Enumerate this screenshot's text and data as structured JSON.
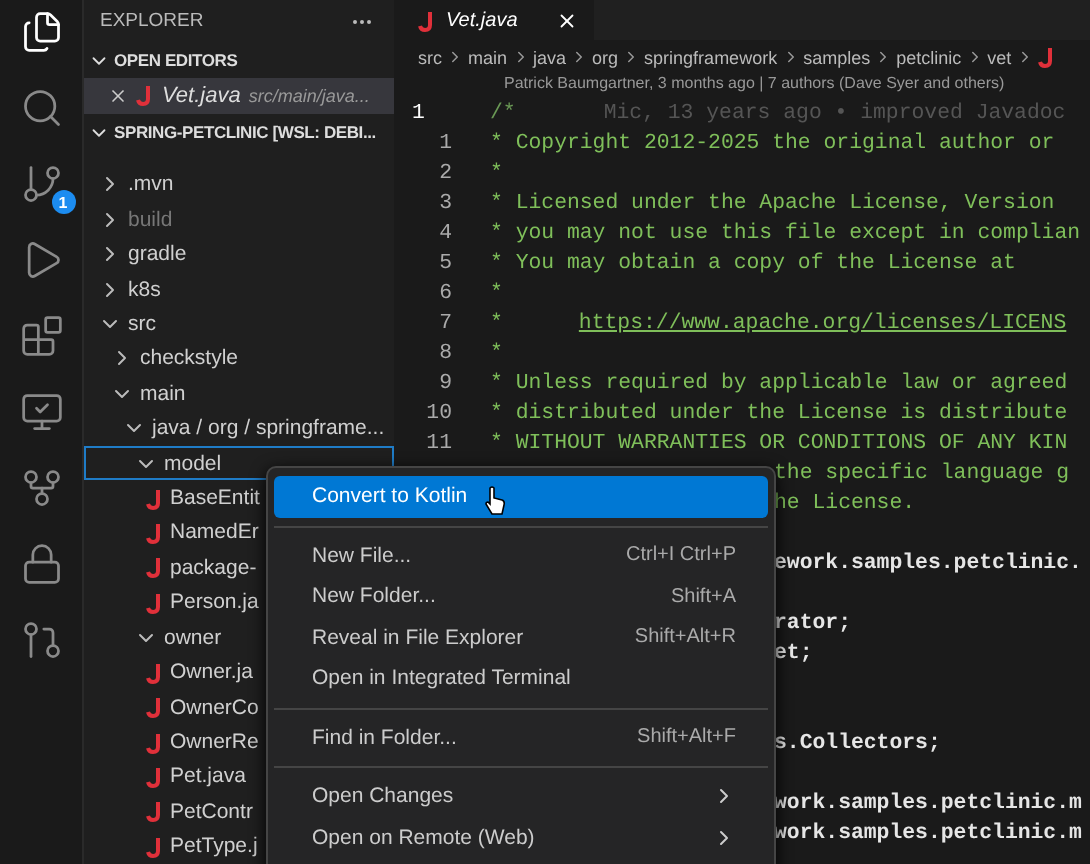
{
  "activity_bar": [
    {
      "selected": true
    },
    {
      "selected": false
    },
    {
      "selected": false,
      "badge": "1"
    },
    {
      "selected": false
    },
    {
      "selected": false
    },
    {
      "selected": false
    },
    {
      "selected": false
    },
    {
      "selected": false
    },
    {
      "selected": false
    }
  ],
  "sidebar": {
    "title": "EXPLORER",
    "open_editors": {
      "title": "OPEN EDITORS",
      "expanded": true,
      "items": [
        {
          "name": "Vet.java",
          "path": "src/main/java...",
          "selected": true
        }
      ]
    },
    "project": {
      "title": "SPRING-PETCLINIC [WSL: DEBI...",
      "expanded": true,
      "items": [
        {
          "label": ".mvn",
          "kind": "folder",
          "expanded": false,
          "dimmed": false,
          "selected": false
        },
        {
          "label": "build",
          "kind": "folder",
          "expanded": false,
          "dimmed": true,
          "selected": false
        },
        {
          "label": "gradle",
          "kind": "folder",
          "expanded": false,
          "dimmed": false,
          "selected": false
        },
        {
          "label": "k8s",
          "kind": "folder",
          "expanded": false,
          "dimmed": false,
          "selected": false
        },
        {
          "label": "src",
          "kind": "folder",
          "expanded": true,
          "dimmed": false,
          "selected": false,
          "children": [
            {
              "label": "checkstyle",
              "kind": "folder",
              "expanded": false,
              "dimmed": false,
              "selected": false
            },
            {
              "label": "main",
              "kind": "folder",
              "expanded": true,
              "dimmed": false,
              "selected": false,
              "children": [
                {
                  "label": "java / org / springframe...",
                  "kind": "folder",
                  "expanded": true,
                  "dimmed": false,
                  "selected": false,
                  "children": [
                    {
                      "label": "model",
                      "kind": "folder",
                      "expanded": true,
                      "dimmed": false,
                      "selected": true,
                      "children": [
                        {
                          "label": "BaseEntit",
                          "kind": "java",
                          "dimmed": false,
                          "selected": false
                        },
                        {
                          "label": "NamedEr",
                          "kind": "java",
                          "dimmed": false,
                          "selected": false
                        },
                        {
                          "label": "package-",
                          "kind": "java",
                          "dimmed": false,
                          "selected": false
                        },
                        {
                          "label": "Person.ja",
                          "kind": "java",
                          "dimmed": false,
                          "selected": false
                        }
                      ]
                    },
                    {
                      "label": "owner",
                      "kind": "folder",
                      "expanded": true,
                      "dimmed": false,
                      "selected": false,
                      "children": [
                        {
                          "label": "Owner.ja",
                          "kind": "java",
                          "dimmed": false,
                          "selected": false
                        },
                        {
                          "label": "OwnerCo",
                          "kind": "java",
                          "dimmed": false,
                          "selected": false
                        },
                        {
                          "label": "OwnerRe",
                          "kind": "java",
                          "dimmed": false,
                          "selected": false
                        },
                        {
                          "label": "Pet.java",
                          "kind": "java",
                          "dimmed": false,
                          "selected": false
                        },
                        {
                          "label": "PetContr",
                          "kind": "java",
                          "dimmed": false,
                          "selected": false
                        },
                        {
                          "label": "PetType.j",
                          "kind": "java",
                          "dimmed": false,
                          "selected": false
                        }
                      ]
                    }
                  ]
                }
              ]
            }
          ]
        }
      ]
    }
  },
  "editor": {
    "tabs": [
      {
        "label": "Vet.java",
        "selected": true
      }
    ],
    "breadcrumb": [
      "src",
      "main",
      "java",
      "org",
      "springframework",
      "samples",
      "petclinic",
      "vet"
    ],
    "blame": "Patrick Baumgartner, 3 months ago | 7 authors (Dave Syer and others)",
    "lines": [
      {
        "kind": "current",
        "number": "1",
        "text": "/*",
        "ghost": "Mic, 13 years ago • improved Javadoc"
      },
      {
        "kind": "comment",
        "number": "1",
        "text": "* Copyright 2012-2025 the original author or"
      },
      {
        "kind": "comment",
        "number": "2",
        "text": "*"
      },
      {
        "kind": "comment",
        "number": "3",
        "text": "* Licensed under the Apache License, Version"
      },
      {
        "kind": "comment",
        "number": "4",
        "text": "* you may not use this file except in complian"
      },
      {
        "kind": "comment",
        "number": "5",
        "text": "* You may obtain a copy of the License at"
      },
      {
        "kind": "comment",
        "number": "6",
        "text": "*"
      },
      {
        "kind": "comment",
        "number": "7",
        "text": "*",
        "link": "https://www.apache.org/licenses/LICENS"
      },
      {
        "kind": "comment",
        "number": "8",
        "text": "*"
      },
      {
        "kind": "comment",
        "number": "9",
        "text": "* Unless required by applicable law or agreed"
      },
      {
        "kind": "comment",
        "number": "10",
        "text": "* distributed under the License is distribute"
      },
      {
        "kind": "comment",
        "number": "11",
        "text": "* WITHOUT WARRANTIES OR CONDITIONS OF ANY KIN"
      },
      {
        "kind": "covered-comment",
        "text": "the specific language g"
      },
      {
        "kind": "covered-comment",
        "text": "he License."
      },
      {
        "kind": "blank"
      },
      {
        "kind": "covered-code",
        "text": "ework.samples.petclinic."
      },
      {
        "kind": "blank"
      },
      {
        "kind": "covered-code",
        "text": "rator;"
      },
      {
        "kind": "covered-code",
        "text": "et;"
      },
      {
        "kind": "blank"
      },
      {
        "kind": "blank"
      },
      {
        "kind": "covered-code",
        "text": "s.Collectors;"
      },
      {
        "kind": "blank"
      },
      {
        "kind": "covered-code",
        "text": "work.samples.petclinic.m"
      },
      {
        "kind": "covered-code",
        "text": "work.samples.petclinic.m"
      }
    ]
  },
  "context_menu": {
    "groups": [
      [
        {
          "label": "Convert to Kotlin",
          "selected": true
        }
      ],
      [
        {
          "label": "New File...",
          "shortcut": "Ctrl+I Ctrl+P",
          "selected": false
        },
        {
          "label": "New Folder...",
          "shortcut": "Shift+A",
          "selected": false
        },
        {
          "label": "Reveal in File Explorer",
          "shortcut": "Shift+Alt+R",
          "selected": false
        },
        {
          "label": "Open in Integrated Terminal",
          "selected": false
        }
      ],
      [
        {
          "label": "Find in Folder...",
          "shortcut": "Shift+Alt+F",
          "selected": false
        }
      ],
      [
        {
          "label": "Open Changes",
          "submenu": true,
          "selected": false
        },
        {
          "label": "Open on Remote (Web)",
          "submenu": true,
          "selected": false
        }
      ]
    ]
  }
}
